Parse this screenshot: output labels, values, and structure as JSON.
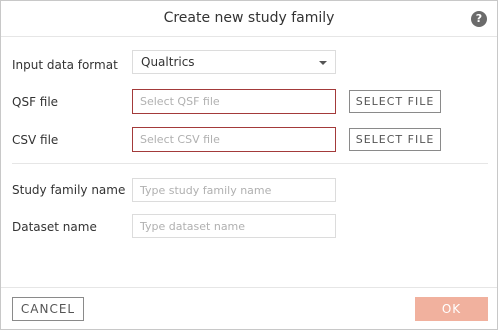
{
  "dialog": {
    "title": "Create new study family",
    "help_icon": "help-icon"
  },
  "form": {
    "input_format": {
      "label": "Input data format",
      "value": "Qualtrics"
    },
    "qsf_file": {
      "label": "QSF file",
      "placeholder": "Select QSF file",
      "button_label": "SELECT FILE"
    },
    "csv_file": {
      "label": "CSV file",
      "placeholder": "Select CSV file",
      "button_label": "SELECT FILE"
    },
    "study_family_name": {
      "label": "Study family name",
      "placeholder": "Type study family name"
    },
    "dataset_name": {
      "label": "Dataset name",
      "placeholder": "Type dataset name"
    }
  },
  "footer": {
    "cancel_label": "CANCEL",
    "ok_label": "OK"
  },
  "colors": {
    "error_border": "#a33a3a",
    "ok_disabled": "#f1b19e"
  }
}
